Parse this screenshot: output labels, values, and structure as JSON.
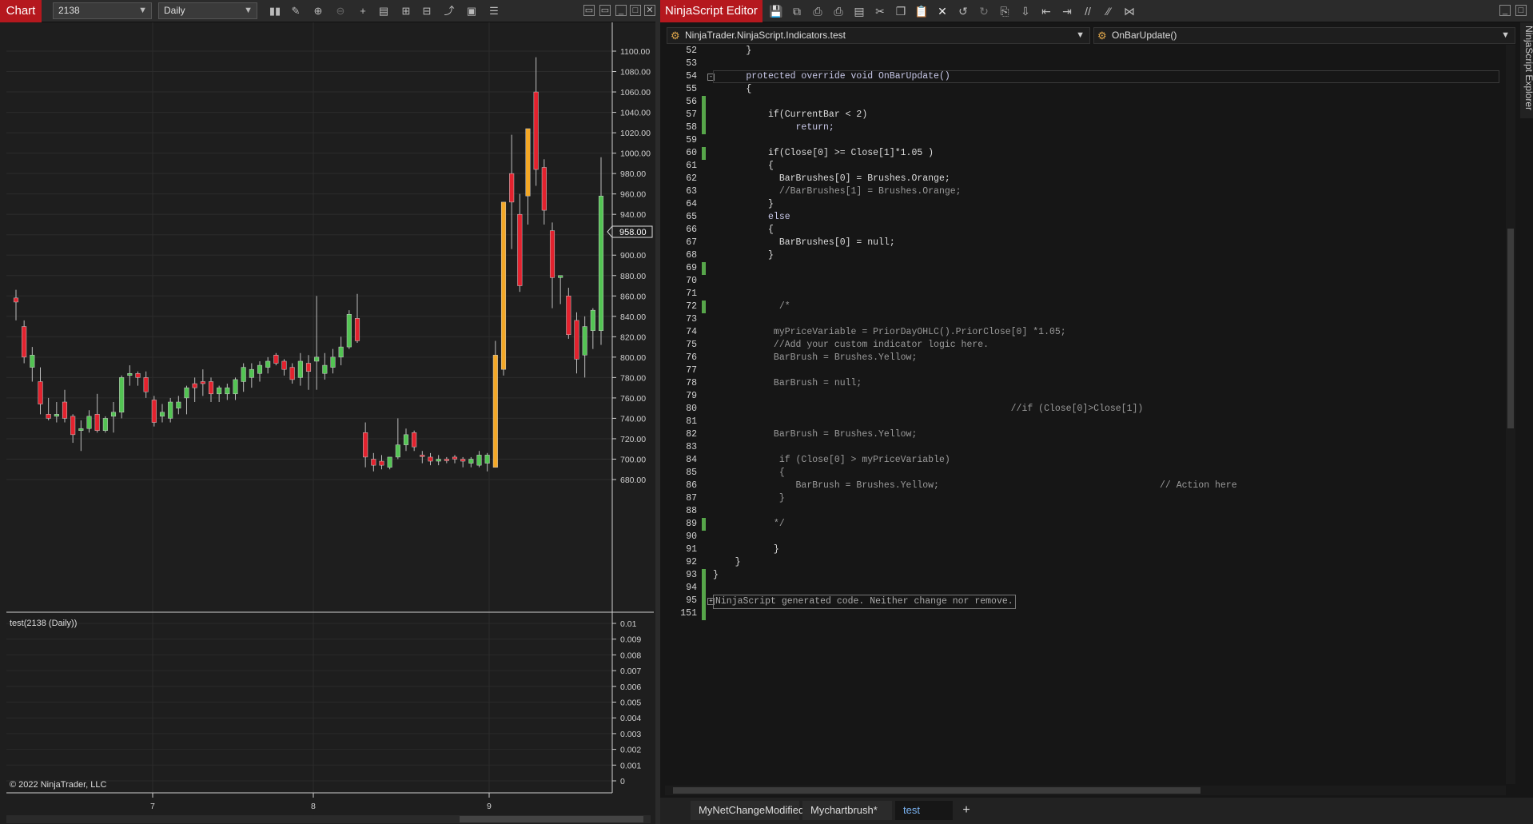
{
  "chart_window": {
    "title": "Chart",
    "instrument": "2138",
    "period": "Daily",
    "copyright": "© 2022 NinjaTrader, LLC",
    "indicator_label": "test(2138 (Daily))",
    "current_price": "958.00",
    "price_axis": [
      "1100.00",
      "1080.00",
      "1060.00",
      "1040.00",
      "1020.00",
      "1000.00",
      "980.00",
      "960.00",
      "940.00",
      "920.00",
      "900.00",
      "880.00",
      "860.00",
      "840.00",
      "820.00",
      "800.00",
      "780.00",
      "760.00",
      "740.00",
      "720.00",
      "700.00",
      "680.00"
    ],
    "oscillator_axis": [
      "0.01",
      "0.009",
      "0.008",
      "0.007",
      "0.006",
      "0.005",
      "0.004",
      "0.003",
      "0.002",
      "0.001",
      "0"
    ],
    "time_axis": [
      "7",
      "8",
      "9"
    ]
  },
  "chart_data": {
    "type": "candlestick",
    "ylim": [
      670,
      1110
    ],
    "bars": [
      {
        "o": 858,
        "h": 866,
        "l": 836,
        "c": 854,
        "color": "red"
      },
      {
        "o": 830,
        "h": 836,
        "l": 794,
        "c": 800,
        "color": "red"
      },
      {
        "o": 790,
        "h": 810,
        "l": 776,
        "c": 802,
        "color": "green"
      },
      {
        "o": 776,
        "h": 790,
        "l": 744,
        "c": 754,
        "color": "red"
      },
      {
        "o": 744,
        "h": 760,
        "l": 738,
        "c": 740,
        "color": "red"
      },
      {
        "o": 742,
        "h": 756,
        "l": 736,
        "c": 744,
        "color": "green"
      },
      {
        "o": 756,
        "h": 768,
        "l": 736,
        "c": 740,
        "color": "red"
      },
      {
        "o": 742,
        "h": 744,
        "l": 716,
        "c": 724,
        "color": "red"
      },
      {
        "o": 728,
        "h": 738,
        "l": 708,
        "c": 730,
        "color": "green"
      },
      {
        "o": 730,
        "h": 748,
        "l": 726,
        "c": 742,
        "color": "green"
      },
      {
        "o": 744,
        "h": 764,
        "l": 726,
        "c": 728,
        "color": "red"
      },
      {
        "o": 728,
        "h": 742,
        "l": 726,
        "c": 740,
        "color": "green"
      },
      {
        "o": 742,
        "h": 756,
        "l": 726,
        "c": 746,
        "color": "green"
      },
      {
        "o": 746,
        "h": 782,
        "l": 740,
        "c": 780,
        "color": "green"
      },
      {
        "o": 782,
        "h": 792,
        "l": 772,
        "c": 784,
        "color": "green"
      },
      {
        "o": 784,
        "h": 786,
        "l": 772,
        "c": 780,
        "color": "red"
      },
      {
        "o": 780,
        "h": 786,
        "l": 760,
        "c": 766,
        "color": "red"
      },
      {
        "o": 758,
        "h": 762,
        "l": 732,
        "c": 736,
        "color": "red"
      },
      {
        "o": 742,
        "h": 754,
        "l": 736,
        "c": 746,
        "color": "green"
      },
      {
        "o": 740,
        "h": 760,
        "l": 736,
        "c": 756,
        "color": "green"
      },
      {
        "o": 750,
        "h": 762,
        "l": 744,
        "c": 756,
        "color": "green"
      },
      {
        "o": 760,
        "h": 772,
        "l": 744,
        "c": 770,
        "color": "green"
      },
      {
        "o": 770,
        "h": 780,
        "l": 756,
        "c": 774,
        "color": "red"
      },
      {
        "o": 774,
        "h": 788,
        "l": 762,
        "c": 776,
        "color": "red"
      },
      {
        "o": 776,
        "h": 780,
        "l": 756,
        "c": 764,
        "color": "red"
      },
      {
        "o": 764,
        "h": 772,
        "l": 756,
        "c": 770,
        "color": "green"
      },
      {
        "o": 770,
        "h": 774,
        "l": 758,
        "c": 764,
        "color": "green"
      },
      {
        "o": 764,
        "h": 780,
        "l": 758,
        "c": 778,
        "color": "green"
      },
      {
        "o": 776,
        "h": 794,
        "l": 766,
        "c": 790,
        "color": "green"
      },
      {
        "o": 780,
        "h": 794,
        "l": 770,
        "c": 788,
        "color": "green"
      },
      {
        "o": 784,
        "h": 796,
        "l": 776,
        "c": 792,
        "color": "green"
      },
      {
        "o": 790,
        "h": 800,
        "l": 784,
        "c": 796,
        "color": "green"
      },
      {
        "o": 802,
        "h": 804,
        "l": 792,
        "c": 794,
        "color": "red"
      },
      {
        "o": 796,
        "h": 798,
        "l": 782,
        "c": 788,
        "color": "red"
      },
      {
        "o": 790,
        "h": 794,
        "l": 774,
        "c": 778,
        "color": "red"
      },
      {
        "o": 780,
        "h": 804,
        "l": 772,
        "c": 796,
        "color": "green"
      },
      {
        "o": 786,
        "h": 802,
        "l": 768,
        "c": 794,
        "color": "red"
      },
      {
        "o": 796,
        "h": 860,
        "l": 768,
        "c": 800,
        "color": "green"
      },
      {
        "o": 784,
        "h": 804,
        "l": 778,
        "c": 792,
        "color": "green"
      },
      {
        "o": 790,
        "h": 808,
        "l": 784,
        "c": 800,
        "color": "green"
      },
      {
        "o": 800,
        "h": 820,
        "l": 792,
        "c": 810,
        "color": "green"
      },
      {
        "o": 810,
        "h": 846,
        "l": 808,
        "c": 842,
        "color": "green"
      },
      {
        "o": 838,
        "h": 862,
        "l": 814,
        "c": 816,
        "color": "red"
      },
      {
        "o": 726,
        "h": 736,
        "l": 692,
        "c": 702,
        "color": "red"
      },
      {
        "o": 700,
        "h": 706,
        "l": 688,
        "c": 694,
        "color": "red"
      },
      {
        "o": 698,
        "h": 704,
        "l": 690,
        "c": 694,
        "color": "red"
      },
      {
        "o": 692,
        "h": 702,
        "l": 690,
        "c": 702,
        "color": "green"
      },
      {
        "o": 702,
        "h": 740,
        "l": 700,
        "c": 714,
        "color": "green"
      },
      {
        "o": 714,
        "h": 730,
        "l": 708,
        "c": 724,
        "color": "green"
      },
      {
        "o": 726,
        "h": 728,
        "l": 708,
        "c": 712,
        "color": "red"
      },
      {
        "o": 704,
        "h": 708,
        "l": 696,
        "c": 704,
        "color": "red"
      },
      {
        "o": 702,
        "h": 706,
        "l": 694,
        "c": 698,
        "color": "red"
      },
      {
        "o": 698,
        "h": 704,
        "l": 694,
        "c": 700,
        "color": "green"
      },
      {
        "o": 700,
        "h": 702,
        "l": 696,
        "c": 700,
        "color": "red"
      },
      {
        "o": 700,
        "h": 704,
        "l": 696,
        "c": 702,
        "color": "red"
      },
      {
        "o": 700,
        "h": 702,
        "l": 692,
        "c": 698,
        "color": "red"
      },
      {
        "o": 696,
        "h": 702,
        "l": 692,
        "c": 700,
        "color": "green"
      },
      {
        "o": 694,
        "h": 708,
        "l": 692,
        "c": 704,
        "color": "green"
      },
      {
        "o": 704,
        "h": 706,
        "l": 688,
        "c": 696,
        "color": "green"
      },
      {
        "o": 692,
        "h": 816,
        "l": 692,
        "c": 802,
        "color": "orange"
      },
      {
        "o": 788,
        "h": 950,
        "l": 782,
        "c": 952,
        "color": "orange"
      },
      {
        "o": 980,
        "h": 1018,
        "l": 906,
        "c": 952,
        "color": "red"
      },
      {
        "o": 940,
        "h": 960,
        "l": 864,
        "c": 870,
        "color": "red"
      },
      {
        "o": 958,
        "h": 1020,
        "l": 930,
        "c": 1024,
        "color": "orange"
      },
      {
        "o": 1060,
        "h": 1094,
        "l": 968,
        "c": 984,
        "color": "red"
      },
      {
        "o": 986,
        "h": 994,
        "l": 930,
        "c": 944,
        "color": "red"
      },
      {
        "o": 924,
        "h": 932,
        "l": 848,
        "c": 878,
        "color": "red"
      },
      {
        "o": 880,
        "h": 880,
        "l": 852,
        "c": 878,
        "color": "green"
      },
      {
        "o": 860,
        "h": 868,
        "l": 818,
        "c": 822,
        "color": "red"
      },
      {
        "o": 836,
        "h": 844,
        "l": 784,
        "c": 798,
        "color": "red"
      },
      {
        "o": 802,
        "h": 840,
        "l": 780,
        "c": 830,
        "color": "green"
      },
      {
        "o": 826,
        "h": 848,
        "l": 808,
        "c": 846,
        "color": "green"
      },
      {
        "o": 826,
        "h": 996,
        "l": 812,
        "c": 958,
        "color": "green"
      }
    ],
    "colors": {
      "green": "#53c453",
      "red": "#e3222e",
      "orange": "#f4a826"
    }
  },
  "editor_window": {
    "title": "NinjaScript Editor",
    "nav_class": "NinjaTrader.NinjaScript.Indicators.test",
    "nav_member": "OnBarUpdate()",
    "explorer_label": "NinjaScript Explorer",
    "tabs": [
      "MyNetChangeModified",
      "Mychartbrush*",
      "test"
    ],
    "active_tab": "test",
    "add_tab": "+",
    "lines": [
      {
        "n": "52",
        "t": "      }",
        "chg": false,
        "cls": "c-norm"
      },
      {
        "n": "53",
        "t": "",
        "chg": false,
        "cls": "c-norm"
      },
      {
        "n": "54",
        "t": "      protected override void OnBarUpdate()",
        "chg": false,
        "cls": "c-kw",
        "fold": "-"
      },
      {
        "n": "55",
        "t": "      {",
        "chg": false,
        "cls": "c-norm"
      },
      {
        "n": "56",
        "t": "",
        "chg": true,
        "cls": "c-norm"
      },
      {
        "n": "57",
        "t": "          if(CurrentBar < 2)",
        "chg": true,
        "cls": "c-norm"
      },
      {
        "n": "58",
        "t": "               return;",
        "chg": true,
        "cls": "c-kw"
      },
      {
        "n": "59",
        "t": "",
        "chg": false,
        "cls": "c-norm"
      },
      {
        "n": "60",
        "t": "          if(Close[0] >= Close[1]*1.05 )",
        "chg": true,
        "cls": "c-norm"
      },
      {
        "n": "61",
        "t": "          {",
        "chg": false,
        "cls": "c-norm"
      },
      {
        "n": "62",
        "t": "            BarBrushes[0] = Brushes.Orange;",
        "chg": false,
        "cls": "c-norm"
      },
      {
        "n": "63",
        "t": "            //BarBrushes[1] = Brushes.Orange;",
        "chg": false,
        "cls": "c-com"
      },
      {
        "n": "64",
        "t": "          }",
        "chg": false,
        "cls": "c-norm"
      },
      {
        "n": "65",
        "t": "          else",
        "chg": false,
        "cls": "c-kw"
      },
      {
        "n": "66",
        "t": "          {",
        "chg": false,
        "cls": "c-norm"
      },
      {
        "n": "67",
        "t": "            BarBrushes[0] = null;",
        "chg": false,
        "cls": "c-norm"
      },
      {
        "n": "68",
        "t": "          }",
        "chg": false,
        "cls": "c-norm"
      },
      {
        "n": "69",
        "t": "",
        "chg": true,
        "cls": "c-norm"
      },
      {
        "n": "70",
        "t": "",
        "chg": false,
        "cls": "c-norm"
      },
      {
        "n": "71",
        "t": "",
        "chg": false,
        "cls": "c-norm"
      },
      {
        "n": "72",
        "t": "            /*",
        "chg": true,
        "cls": "c-com"
      },
      {
        "n": "73",
        "t": "",
        "chg": false,
        "cls": "c-com"
      },
      {
        "n": "74",
        "t": "           myPriceVariable = PriorDayOHLC().PriorClose[0] *1.05;",
        "chg": false,
        "cls": "c-com"
      },
      {
        "n": "75",
        "t": "           //Add your custom indicator logic here.",
        "chg": false,
        "cls": "c-com"
      },
      {
        "n": "76",
        "t": "           BarBrush = Brushes.Yellow;",
        "chg": false,
        "cls": "c-com"
      },
      {
        "n": "77",
        "t": "",
        "chg": false,
        "cls": "c-com"
      },
      {
        "n": "78",
        "t": "           BarBrush = null;",
        "chg": false,
        "cls": "c-com"
      },
      {
        "n": "79",
        "t": "",
        "chg": false,
        "cls": "c-com"
      },
      {
        "n": "80",
        "t": "                                                      //if (Close[0]>Close[1])",
        "chg": false,
        "cls": "c-com"
      },
      {
        "n": "81",
        "t": "",
        "chg": false,
        "cls": "c-com"
      },
      {
        "n": "82",
        "t": "           BarBrush = Brushes.Yellow;",
        "chg": false,
        "cls": "c-com"
      },
      {
        "n": "83",
        "t": "",
        "chg": false,
        "cls": "c-com"
      },
      {
        "n": "84",
        "t": "            if (Close[0] > myPriceVariable)",
        "chg": false,
        "cls": "c-com"
      },
      {
        "n": "85",
        "t": "            {",
        "chg": false,
        "cls": "c-com"
      },
      {
        "n": "86",
        "t": "               BarBrush = Brushes.Yellow;                                        // Action here",
        "chg": false,
        "cls": "c-com"
      },
      {
        "n": "87",
        "t": "            }",
        "chg": false,
        "cls": "c-com"
      },
      {
        "n": "88",
        "t": "",
        "chg": false,
        "cls": "c-com"
      },
      {
        "n": "89",
        "t": "           */",
        "chg": true,
        "cls": "c-com"
      },
      {
        "n": "90",
        "t": "",
        "chg": false,
        "cls": "c-norm"
      },
      {
        "n": "91",
        "t": "           }",
        "chg": false,
        "cls": "c-norm"
      },
      {
        "n": "92",
        "t": "    }",
        "chg": false,
        "cls": "c-norm"
      },
      {
        "n": "93",
        "t": "}",
        "chg": true,
        "cls": "c-norm"
      },
      {
        "n": "94",
        "t": "",
        "chg": true,
        "cls": "c-norm"
      },
      {
        "n": "95",
        "t": "NinjaScript generated code. Neither change nor remove.",
        "chg": true,
        "cls": "c-com",
        "fold": "+",
        "box": true
      },
      {
        "n": "151",
        "t": "",
        "chg": true,
        "cls": "c-norm"
      }
    ]
  }
}
